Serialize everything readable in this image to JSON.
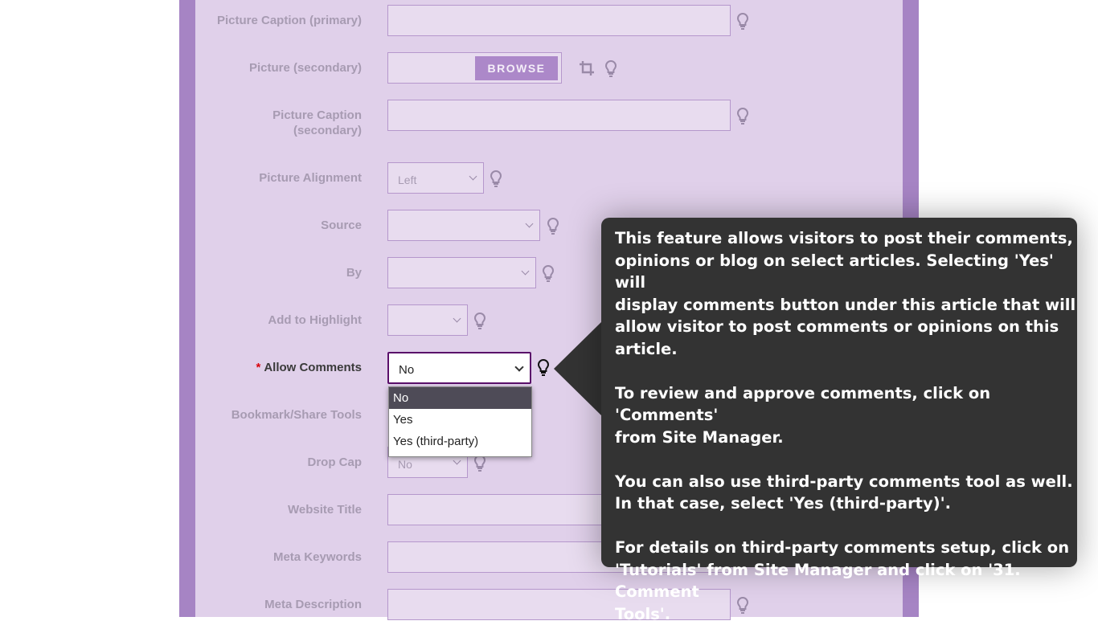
{
  "form": {
    "fields": {
      "caption_primary": {
        "label": "Picture Caption (primary)",
        "value": ""
      },
      "picture_secondary": {
        "label": "Picture (secondary)",
        "browse_label": "BROWSE"
      },
      "caption_secondary": {
        "label": "Picture Caption\n(secondary)",
        "value": ""
      },
      "alignment": {
        "label": "Picture Alignment",
        "value": "Left"
      },
      "source": {
        "label": "Source",
        "value": ""
      },
      "by": {
        "label": "By",
        "value": ""
      },
      "highlight": {
        "label": "Add to Highlight",
        "value": ""
      },
      "allow_comments": {
        "label": "Allow Comments",
        "required_mark": "*",
        "value": "No",
        "options": [
          "No",
          "Yes",
          "Yes (third-party)"
        ]
      },
      "bookmark": {
        "label": "Bookmark/Share Tools"
      },
      "dropcap": {
        "label": "Drop Cap",
        "value": "No"
      },
      "website_title": {
        "label": "Website Title",
        "value": ""
      },
      "meta_keywords": {
        "label": "Meta Keywords",
        "value": ""
      },
      "meta_description": {
        "label": "Meta Description",
        "value": ""
      }
    }
  },
  "tooltip": {
    "paragraphs": [
      "This feature allows visitors to post their comments,\nopinions or blog on select articles. Selecting 'Yes' will\ndisplay comments button under this article that will\nallow visitor to post comments or opinions on this\narticle.",
      "To review and approve comments, click on 'Comments'\nfrom Site Manager.",
      "You can also use third-party comments tool as well.\nIn that case, select 'Yes (third-party)'.",
      "For details on third-party comments setup, click on\n'Tutorials' from Site Manager and click on '31. Comment\nTools'."
    ]
  },
  "colors": {
    "panel_border": "#a684c4",
    "panel_bg": "#e0d0ea",
    "browse_button": "#ac88c9",
    "tooltip_bg": "#333333",
    "required": "#d9000b"
  }
}
